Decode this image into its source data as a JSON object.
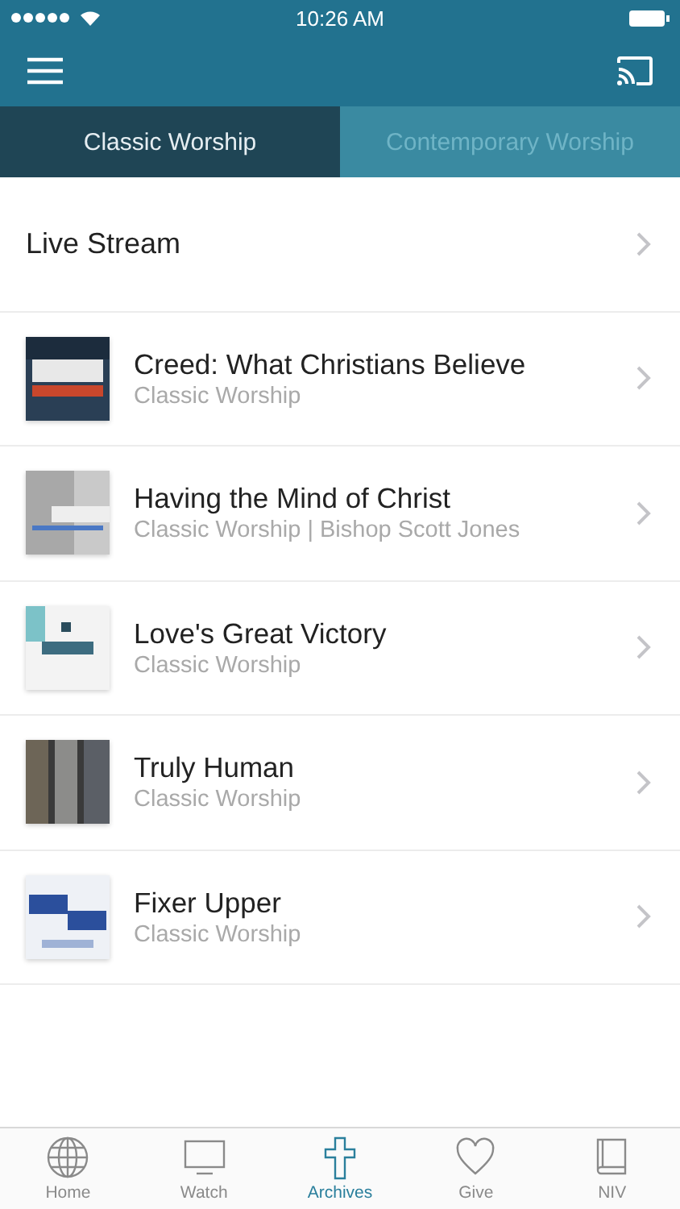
{
  "status_bar": {
    "time": "10:26 AM"
  },
  "tabs": [
    {
      "label": "Classic Worship",
      "selected": true
    },
    {
      "label": "Contemporary Worship",
      "selected": false
    }
  ],
  "live_stream": {
    "label": "Live Stream"
  },
  "sermons": [
    {
      "title": "Creed: What Christians Believe",
      "subtitle": "Classic Worship"
    },
    {
      "title": "Having the Mind of Christ",
      "subtitle": "Classic Worship | Bishop Scott Jones"
    },
    {
      "title": "Love's Great Victory",
      "subtitle": "Classic Worship"
    },
    {
      "title": "Truly Human",
      "subtitle": "Classic Worship"
    },
    {
      "title": "Fixer Upper",
      "subtitle": "Classic Worship"
    }
  ],
  "tab_bar": [
    {
      "label": "Home",
      "selected": false
    },
    {
      "label": "Watch",
      "selected": false
    },
    {
      "label": "Archives",
      "selected": true
    },
    {
      "label": "Give",
      "selected": false
    },
    {
      "label": "NIV",
      "selected": false
    }
  ]
}
